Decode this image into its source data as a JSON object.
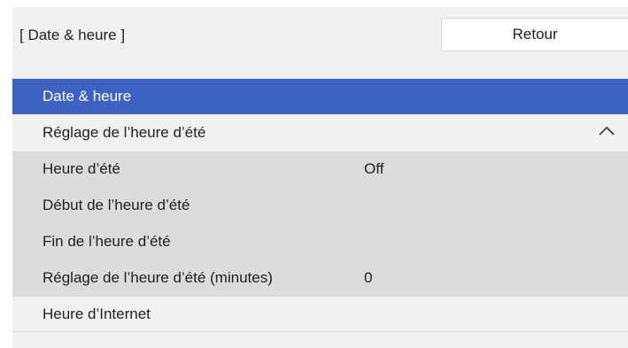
{
  "header": {
    "breadcrumb": "[ Date & heure ]",
    "back_label": "Retour"
  },
  "menu": {
    "selected": {
      "label": "Date & heure"
    },
    "dst_group": {
      "label": "Réglage de l’heure d’été",
      "state": "expanded"
    },
    "sub_items": [
      {
        "label": "Heure d’été",
        "value": "Off"
      },
      {
        "label": "Début de l’heure d’été",
        "value": ""
      },
      {
        "label": "Fin de l’heure d’été",
        "value": ""
      },
      {
        "label": "Réglage de l’heure d’été (minutes)",
        "value": "0"
      }
    ],
    "internet": {
      "label": "Heure d’Internet"
    }
  },
  "colors": {
    "selected_bg": "#3d62c4",
    "panel_bg": "#f1f1f1",
    "sub_bg": "#dcdcdc"
  },
  "icons": {
    "collapse": "chevron-up-icon"
  }
}
